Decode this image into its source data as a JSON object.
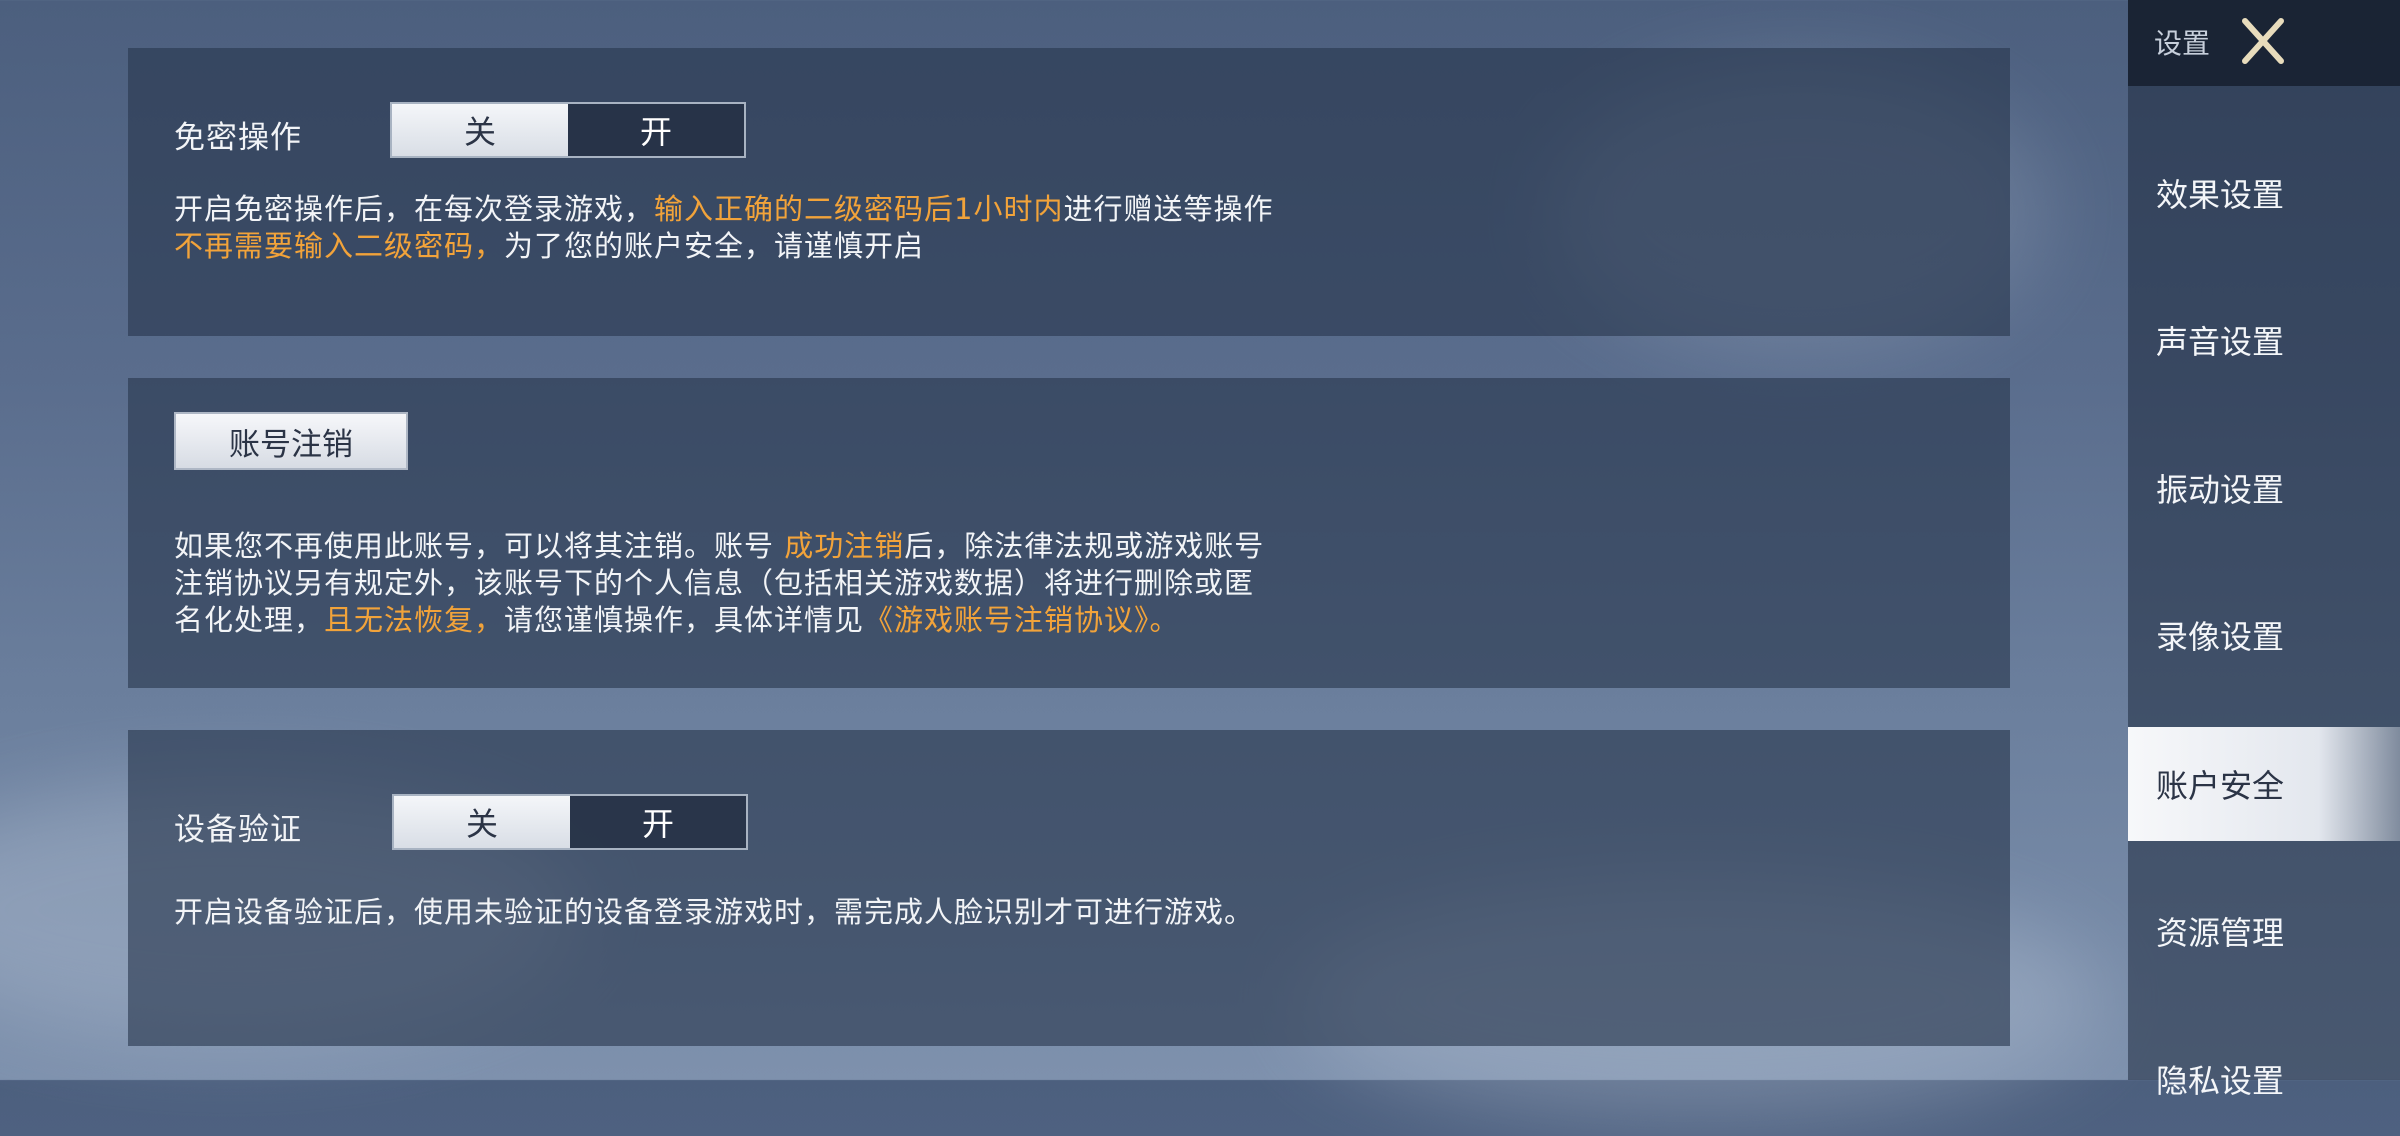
{
  "panel_1": {
    "label": "免密操作",
    "toggle": {
      "off": "关",
      "on": "开",
      "selected": "关"
    },
    "desc_line1_a": "开启免密操作后，在每次登录游戏，",
    "desc_line1_b": "输入正确的二级密码后1小时内",
    "desc_line1_c": "进行赠送等操作",
    "desc_line2_a": "不再需要输入二级密码，",
    "desc_line2_b": "为了您的账户安全，请谨慎开启"
  },
  "panel_2": {
    "button": "账号注销",
    "line1_a": "如果您不再使用此账号，可以将其注销。账号 ",
    "line1_b": "成功注销",
    "line1_c": "后，除法律法规或游戏账号",
    "line2": "注销协议另有规定外，该账号下的个人信息（包括相关游戏数据）将进行删除或匿",
    "line3_a": "名化处理，",
    "line3_b": "且无法恢复，",
    "line3_c": "请您谨慎操作，具体详情见",
    "line3_d": "《游戏账号注销协议》。"
  },
  "panel_3": {
    "label": "设备验证",
    "toggle": {
      "off": "关",
      "on": "开",
      "selected": "关"
    },
    "desc": "开启设备验证后，使用未验证的设备登录游戏时，需完成人脸识别才可进行游戏。"
  },
  "sidebar": {
    "title": "设置",
    "items": [
      {
        "label": "效果设置",
        "active": false
      },
      {
        "label": "声音设置",
        "active": false
      },
      {
        "label": "振动设置",
        "active": false
      },
      {
        "label": "录像设置",
        "active": false
      },
      {
        "label": "账户安全",
        "active": true
      },
      {
        "label": "资源管理",
        "active": false
      },
      {
        "label": "隐私设置",
        "active": false
      }
    ]
  },
  "colors": {
    "highlight": "#f2a33a",
    "panel": "#28374e",
    "active_segment": "#e8ecf2"
  },
  "icons": {
    "close": "close-x-icon"
  }
}
